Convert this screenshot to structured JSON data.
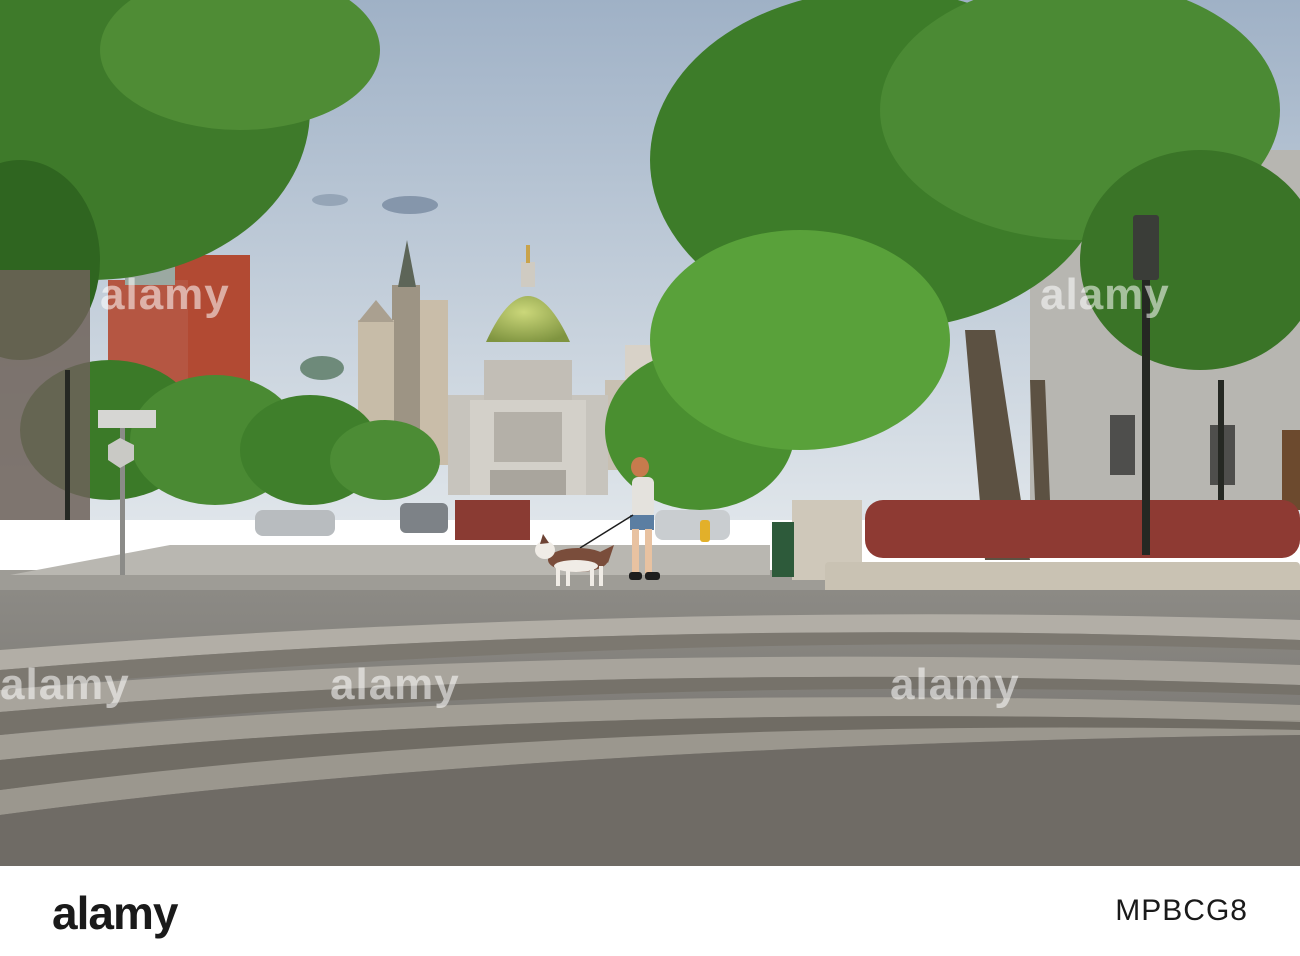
{
  "watermark": {
    "text": "alamy"
  },
  "footer": {
    "logo": "alamy",
    "image_id": "MPBCG8"
  },
  "colors": {
    "sky": "#b7c6d6",
    "foliage": "#3f7d2c",
    "dome": "#a9b85a",
    "pavement": "#8b8780",
    "steps": "#a39f97",
    "footer_bg": "#ffffff"
  }
}
